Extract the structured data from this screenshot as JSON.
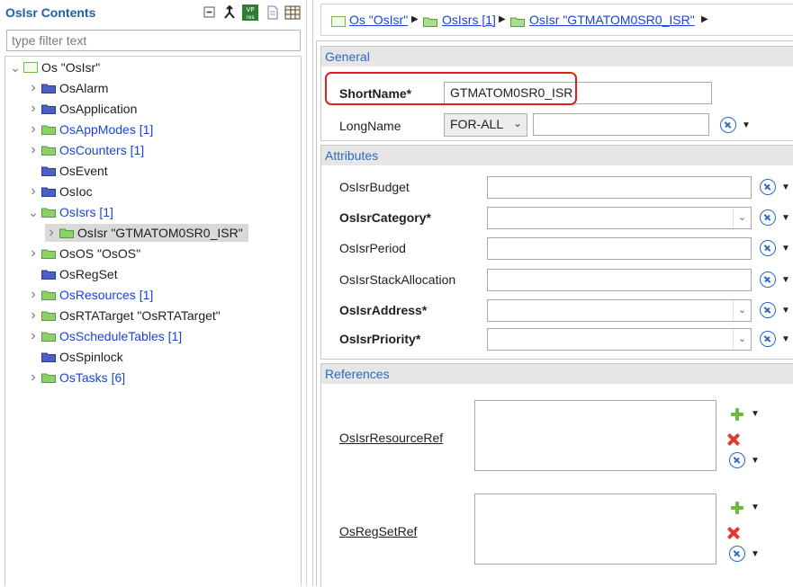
{
  "left_panel": {
    "title": "OsIsr Contents",
    "filter_placeholder": "type filter text",
    "tools": [
      "collapse-all-icon",
      "link-icon",
      "vp-res-icon",
      "document-icon",
      "table-icon"
    ],
    "tree": [
      {
        "label": "Os \"OsIsr\"",
        "chevron": "expanded",
        "icon": "os-root-icon",
        "color": "dark",
        "selected": false
      },
      {
        "label": "OsAlarm",
        "chevron": "collapsed",
        "icon": "folder-blue-icon",
        "color": "dark",
        "selected": false
      },
      {
        "label": "OsApplication",
        "chevron": "collapsed",
        "icon": "folder-blue-icon",
        "color": "dark",
        "selected": false
      },
      {
        "label": "OsAppModes [1]",
        "chevron": "collapsed",
        "icon": "folder-green-icon",
        "color": "blue",
        "selected": false
      },
      {
        "label": "OsCounters [1]",
        "chevron": "collapsed",
        "icon": "folder-green-icon",
        "color": "blue",
        "selected": false
      },
      {
        "label": "OsEvent",
        "chevron": "none",
        "icon": "folder-blue-icon",
        "color": "dark",
        "selected": false
      },
      {
        "label": "OsIoc",
        "chevron": "collapsed",
        "icon": "folder-blue-icon",
        "color": "dark",
        "selected": false
      },
      {
        "label": "OsIsrs [1]",
        "chevron": "expanded",
        "icon": "folder-green-icon",
        "color": "blue",
        "selected": false
      },
      {
        "label": "OsIsr \"GTMATOM0SR0_ISR\"",
        "chevron": "collapsed",
        "icon": "folder-green-icon",
        "color": "dark",
        "selected": true
      },
      {
        "label": "OsOS \"OsOS\"",
        "chevron": "collapsed",
        "icon": "folder-green-icon",
        "color": "dark",
        "selected": false
      },
      {
        "label": "OsRegSet",
        "chevron": "none",
        "icon": "folder-blue-icon",
        "color": "dark",
        "selected": false
      },
      {
        "label": "OsResources [1]",
        "chevron": "collapsed",
        "icon": "folder-green-icon",
        "color": "blue",
        "selected": false
      },
      {
        "label": "OsRTATarget \"OsRTATarget\"",
        "chevron": "collapsed",
        "icon": "folder-green-icon",
        "color": "dark",
        "selected": false
      },
      {
        "label": "OsScheduleTables [1]",
        "chevron": "collapsed",
        "icon": "folder-green-icon",
        "color": "blue",
        "selected": false
      },
      {
        "label": "OsSpinlock",
        "chevron": "none",
        "icon": "folder-blue-icon",
        "color": "dark",
        "selected": false
      },
      {
        "label": "OsTasks [6]",
        "chevron": "collapsed",
        "icon": "folder-green-icon",
        "color": "blue",
        "selected": false
      }
    ]
  },
  "breadcrumb": {
    "items": [
      "Os \"OsIsr\"",
      "OsIsrs [1]",
      "OsIsr \"GTMATOM0SR0_ISR\""
    ]
  },
  "general": {
    "header": "General",
    "short_name_label": "ShortName*",
    "short_name_value": "GTMATOM0SR0_ISR",
    "long_name_label": "LongName",
    "long_name_lang": "FOR-ALL",
    "long_name_value": ""
  },
  "attributes": {
    "header": "Attributes",
    "fields": [
      {
        "label": "OsIsrBudget",
        "kind": "text",
        "required": false,
        "value": ""
      },
      {
        "label": "OsIsrCategory*",
        "kind": "combo",
        "required": true,
        "value": ""
      },
      {
        "label": "OsIsrPeriod",
        "kind": "text",
        "required": false,
        "value": ""
      },
      {
        "label": "OsIsrStackAllocation",
        "kind": "text",
        "required": false,
        "value": ""
      },
      {
        "label": "OsIsrAddress*",
        "kind": "combo",
        "required": true,
        "value": ""
      },
      {
        "label": "OsIsrPriority*",
        "kind": "combo",
        "required": true,
        "value": ""
      }
    ]
  },
  "references": {
    "header": "References",
    "items": [
      {
        "label": "OsIsrResourceRef"
      },
      {
        "label": "OsRegSetRef"
      }
    ]
  },
  "colors": {
    "title_blue": "#1f5fa8",
    "link_blue": "#1a44d6",
    "section_header_bg": "#e6e6e6",
    "highlight_red": "#e01e1e",
    "folder_green": "#8bd06a",
    "folder_blue": "#4b5fc4"
  }
}
